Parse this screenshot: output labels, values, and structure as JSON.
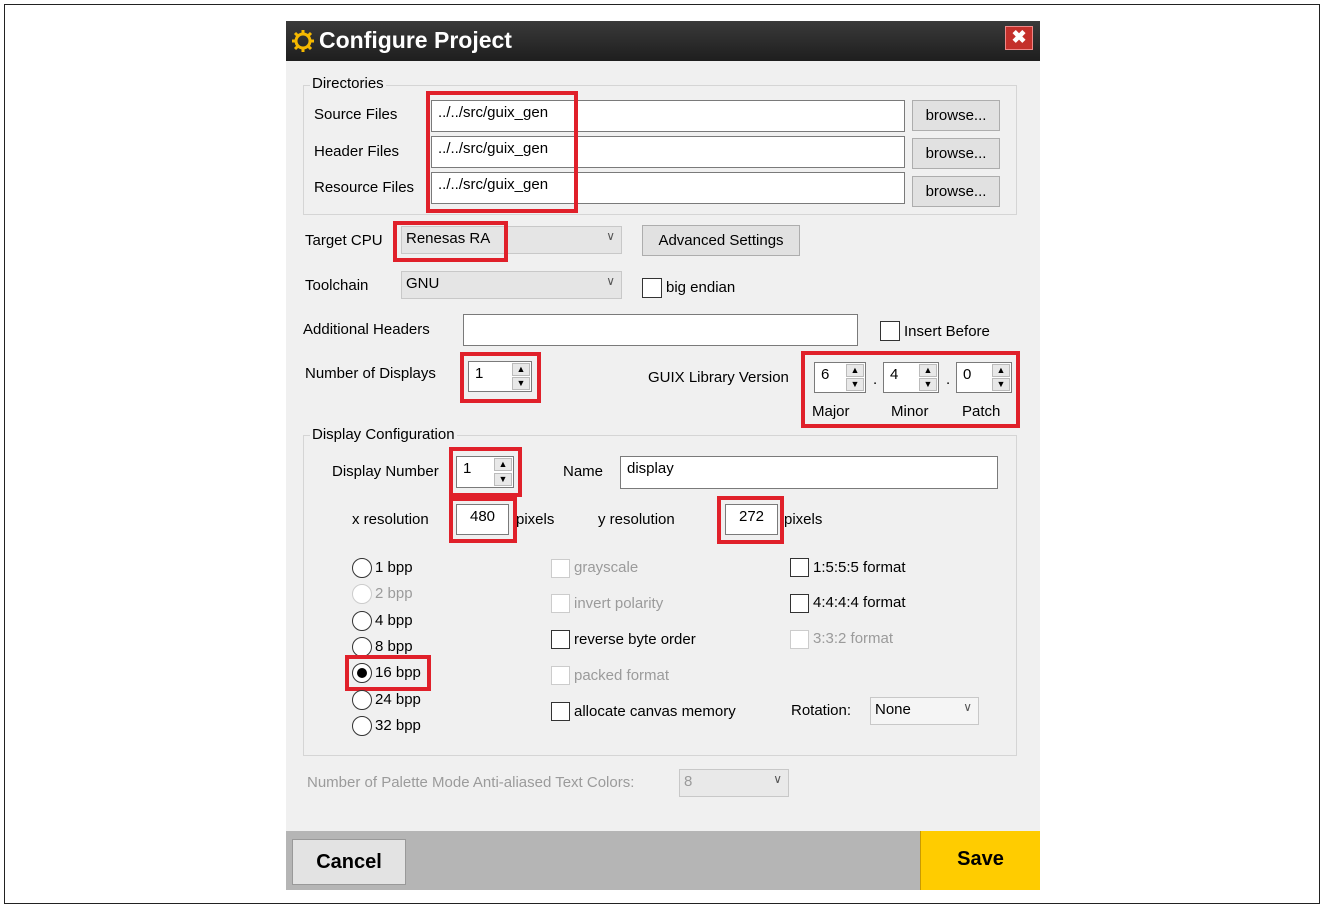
{
  "dialog": {
    "title": "Configure Project",
    "close_glyph": "✖",
    "icon": "gear-icon"
  },
  "directories": {
    "group_label": "Directories",
    "source_label": "Source Files",
    "source_value": "../../src/guix_gen",
    "header_label": "Header Files",
    "header_value": "../../src/guix_gen",
    "resource_label": "Resource Files",
    "resource_value": "../../src/guix_gen",
    "browse_label": "browse..."
  },
  "target": {
    "cpu_label": "Target CPU",
    "cpu_value": "Renesas RA",
    "advanced_label": "Advanced Settings",
    "toolchain_label": "Toolchain",
    "toolchain_value": "GNU",
    "big_endian_label": "big endian"
  },
  "headers": {
    "label": "Additional Headers",
    "value": "",
    "insert_before_label": "Insert Before"
  },
  "displays": {
    "count_label": "Number of Displays",
    "count_value": "1",
    "guix_label": "GUIX Library Version",
    "major": "6",
    "minor": "4",
    "patch": "0",
    "dot": ".",
    "major_label": "Major",
    "minor_label": "Minor",
    "patch_label": "Patch"
  },
  "display_config": {
    "group_label": "Display Configuration",
    "number_label": "Display Number",
    "number_value": "1",
    "name_label": "Name",
    "name_value": "display",
    "xres_label": "x resolution",
    "xres_value": "480",
    "yres_label": "y resolution",
    "yres_value": "272",
    "pixels": "pixels",
    "bpp": [
      "1 bpp",
      "2 bpp",
      "4 bpp",
      "8 bpp",
      "16 bpp",
      "24 bpp",
      "32 bpp"
    ],
    "selected_bpp": "16 bpp",
    "grayscale": "grayscale",
    "invert_polarity": "invert polarity",
    "reverse_byte_order": "reverse byte order",
    "packed_format": "packed format",
    "allocate_canvas": "allocate canvas memory",
    "format_1555": "1:5:5:5 format",
    "format_4444": "4:4:4:4 format",
    "format_332": "3:3:2 format",
    "rotation_label": "Rotation:",
    "rotation_value": "None"
  },
  "palette": {
    "label": "Number of Palette Mode Anti-aliased Text Colors:",
    "value": "8"
  },
  "footer": {
    "cancel_label": "Cancel",
    "save_label": "Save"
  },
  "colors": {
    "highlight": "#e0202a",
    "save": "#ffcc00",
    "title_bar": "#2a2a2a"
  }
}
